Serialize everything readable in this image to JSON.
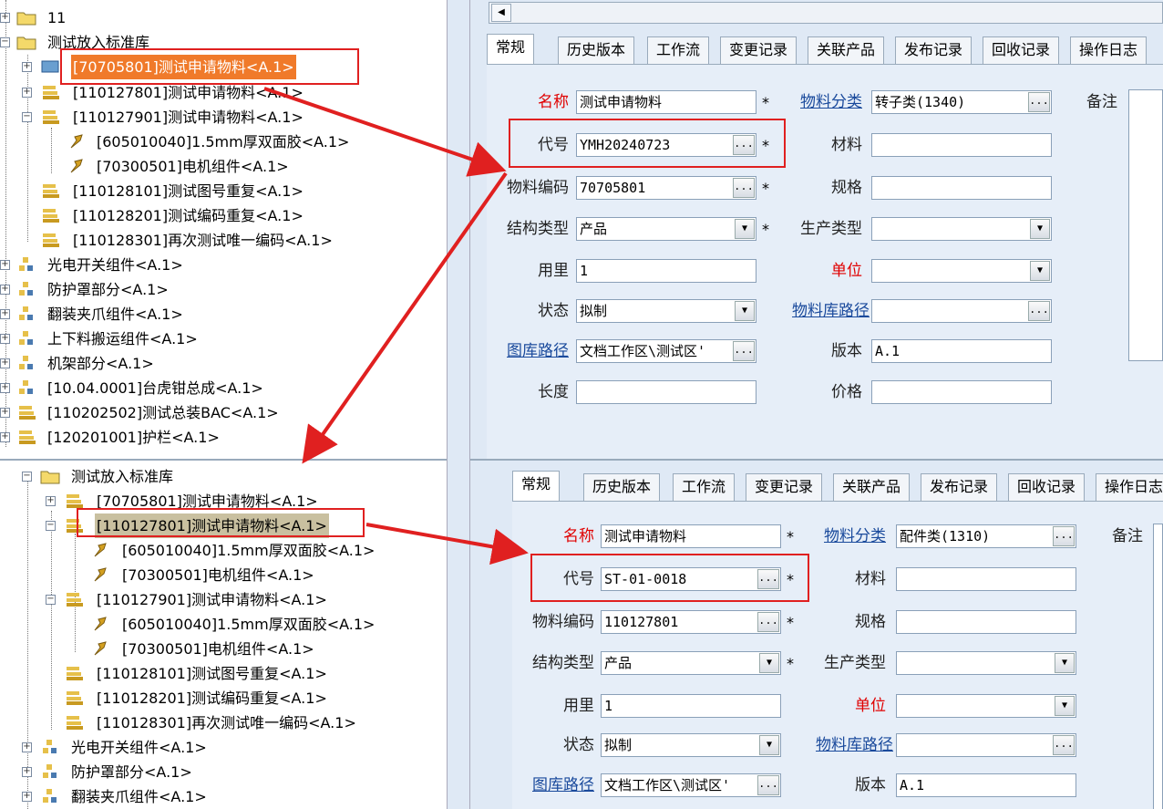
{
  "colors": {
    "highlight_box": "#e02020",
    "arrow": "#e02020",
    "tree_selected": "#f07a2a",
    "tree_selected_2": "#c9c0a0",
    "link": "#1a4a9c",
    "required_label": "#e00000"
  },
  "tabs": [
    "常规",
    "历史版本",
    "工作流",
    "变更记录",
    "关联产品",
    "发布记录",
    "回收记录",
    "操作日志"
  ],
  "labels": {
    "name": "名称",
    "category": "物料分类",
    "note": "备注",
    "code": "代号",
    "material": "材料",
    "material_code": "物料编码",
    "spec": "规格",
    "struct_type": "结构类型",
    "prod_type": "生产类型",
    "qty": "用里",
    "unit": "单位",
    "status": "状态",
    "lib_path": "物料库路径",
    "doc_path": "图库路径",
    "version": "版本",
    "length": "长度",
    "price": "价格",
    "required_mark": "*",
    "dots": "...",
    "drop": "▼"
  },
  "top_form": {
    "name": "测试申请物料",
    "category": "转子类(1340)",
    "code": "YMH20240723",
    "material_code": "70705801",
    "struct_type": "产品",
    "qty": "1",
    "status": "拟制",
    "doc_path": "文档工作区\\测试区'",
    "version": "A.1"
  },
  "bottom_form": {
    "name": "测试申请物料",
    "category": "配件类(1310)",
    "code": "ST-01-0018",
    "material_code": "110127801",
    "struct_type": "产品",
    "qty": "1",
    "status": "拟制",
    "doc_path": "文档工作区\\测试区'",
    "version": "A.1"
  },
  "top_tree": [
    {
      "label": "11",
      "icon": "folder-icon"
    },
    {
      "label": "测试放入标准库",
      "icon": "folder-icon"
    },
    {
      "label": "[70705801]测试申请物料<A.1>",
      "icon": "assembly-blue-icon"
    },
    {
      "label": "[110127801]测试申请物料<A.1>",
      "icon": "assembly-icon"
    },
    {
      "label": "[110127901]测试申请物料<A.1>",
      "icon": "assembly-icon"
    },
    {
      "label": "[605010040]1.5mm厚双面胶<A.1>",
      "icon": "part-icon"
    },
    {
      "label": "[70300501]电机组件<A.1>",
      "icon": "part-icon"
    },
    {
      "label": "[110128101]测试图号重复<A.1>",
      "icon": "assembly-icon"
    },
    {
      "label": "[110128201]测试编码重复<A.1>",
      "icon": "assembly-icon"
    },
    {
      "label": "[110128301]再次测试唯一编码<A.1>",
      "icon": "assembly-icon"
    },
    {
      "label": "光电开关组件<A.1>",
      "icon": "component-icon"
    },
    {
      "label": "防护罩部分<A.1>",
      "icon": "component-icon"
    },
    {
      "label": "翻装夹爪组件<A.1>",
      "icon": "component-icon"
    },
    {
      "label": "上下料搬运组件<A.1>",
      "icon": "component-icon"
    },
    {
      "label": "机架部分<A.1>",
      "icon": "component-icon"
    },
    {
      "label": "[10.04.0001]台虎钳总成<A.1>",
      "icon": "component-icon"
    },
    {
      "label": "[110202502]测试总装BAC<A.1>",
      "icon": "assembly-icon"
    },
    {
      "label": "[120201001]护栏<A.1>",
      "icon": "assembly-icon"
    }
  ],
  "bottom_tree": [
    {
      "label": "测试放入标准库",
      "icon": "folder-icon"
    },
    {
      "label": "[70705801]测试申请物料<A.1>",
      "icon": "assembly-icon"
    },
    {
      "label": "[110127801]测试申请物料<A.1>",
      "icon": "assembly-icon"
    },
    {
      "label": "[605010040]1.5mm厚双面胶<A.1>",
      "icon": "part-icon"
    },
    {
      "label": "[70300501]电机组件<A.1>",
      "icon": "part-icon"
    },
    {
      "label": "[110127901]测试申请物料<A.1>",
      "icon": "assembly-icon"
    },
    {
      "label": "[605010040]1.5mm厚双面胶<A.1>",
      "icon": "part-icon"
    },
    {
      "label": "[70300501]电机组件<A.1>",
      "icon": "part-icon"
    },
    {
      "label": "[110128101]测试图号重复<A.1>",
      "icon": "assembly-icon"
    },
    {
      "label": "[110128201]测试编码重复<A.1>",
      "icon": "assembly-icon"
    },
    {
      "label": "[110128301]再次测试唯一编码<A.1>",
      "icon": "assembly-icon"
    },
    {
      "label": "光电开关组件<A.1>",
      "icon": "component-icon"
    },
    {
      "label": "防护罩部分<A.1>",
      "icon": "component-icon"
    },
    {
      "label": "翻装夹爪组件<A.1>",
      "icon": "component-icon"
    }
  ]
}
